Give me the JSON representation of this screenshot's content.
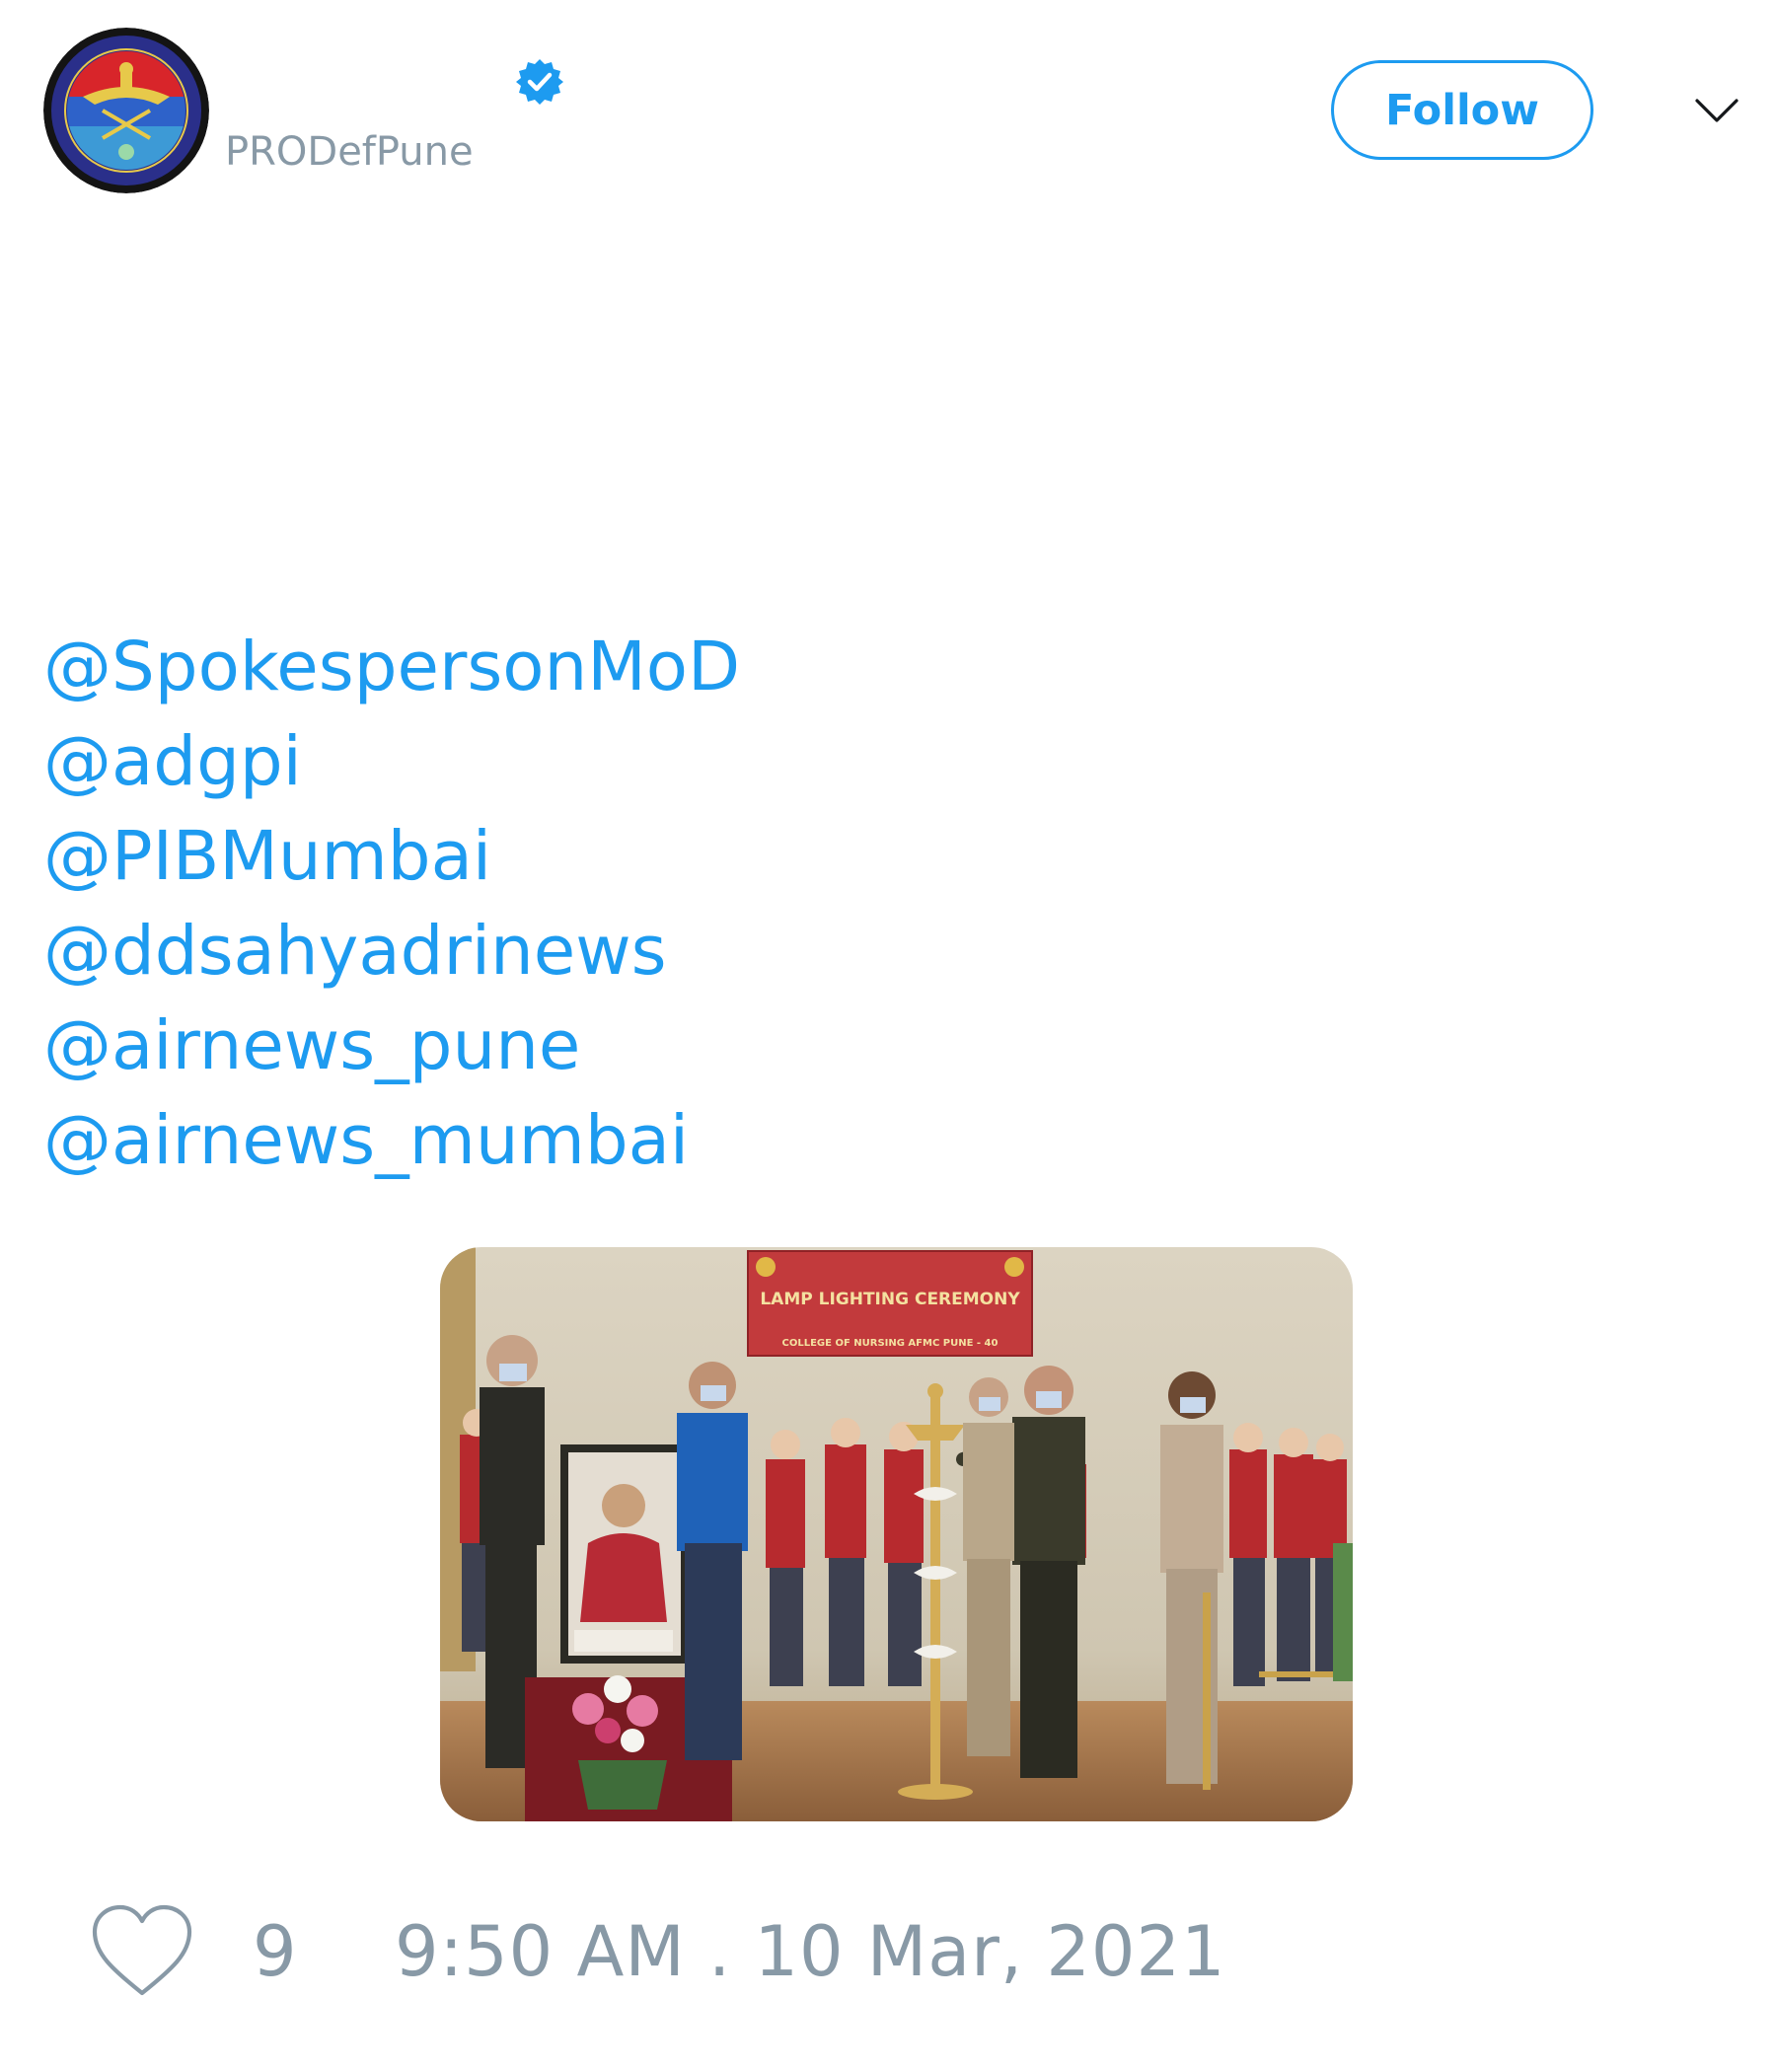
{
  "account": {
    "handle": "PRODefPune",
    "verified": true,
    "avatar_icon": "defence-emblem-avatar",
    "verified_icon": "verified-badge-icon"
  },
  "header": {
    "follow_label": "Follow",
    "menu_icon": "chevron-down-icon"
  },
  "tweet": {
    "mentions": [
      "@SpokespersonMoD",
      "@adgpi",
      "@PIBMumbai",
      "@ddsahyadrinews",
      "@airnews_pune",
      "@airnews_mumbai"
    ],
    "media": {
      "banner_title": "LAMP LIGHTING CEREMONY",
      "banner_subtitle": "COLLEGE OF NURSING AFMC PUNE - 40"
    }
  },
  "footer": {
    "like_icon": "heart-icon",
    "like_count": "9",
    "timestamp": "9:50 AM . 10 Mar, 2021"
  },
  "colors": {
    "link": "#1d9bf0",
    "muted": "#8899a6",
    "background": "#ffffff"
  }
}
